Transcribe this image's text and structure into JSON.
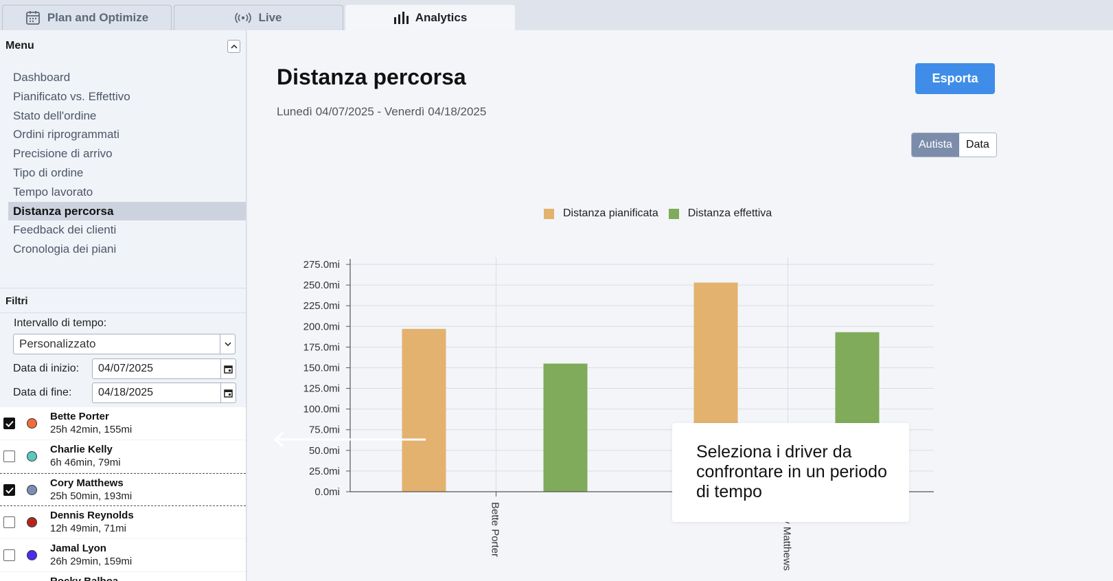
{
  "tabs": [
    {
      "label": "Plan and Optimize",
      "icon": "calendar-icon",
      "active": false
    },
    {
      "label": "Live",
      "icon": "broadcast-icon",
      "active": false
    },
    {
      "label": "Analytics",
      "icon": "bar-chart-icon",
      "active": true
    }
  ],
  "sidebar": {
    "menu_title": "Menu",
    "menu_items": [
      {
        "label": "Dashboard",
        "active": false
      },
      {
        "label": "Pianificato vs. Effettivo",
        "active": false
      },
      {
        "label": "Stato dell'ordine",
        "active": false
      },
      {
        "label": "Ordini riprogrammati",
        "active": false
      },
      {
        "label": "Precisione di arrivo",
        "active": false
      },
      {
        "label": "Tipo di ordine",
        "active": false
      },
      {
        "label": "Tempo lavorato",
        "active": false
      },
      {
        "label": "Distanza percorsa",
        "active": true
      },
      {
        "label": "Feedback dei clienti",
        "active": false
      },
      {
        "label": "Cronologia dei piani",
        "active": false
      }
    ],
    "filters": {
      "title": "Filtri",
      "interval_label": "Intervallo di tempo:",
      "interval_value": "Personalizzato",
      "start_label": "Data di inizio:",
      "start_value": "04/07/2025",
      "end_label": "Data di fine:",
      "end_value": "04/18/2025"
    },
    "drivers": [
      {
        "name": "Bette Porter",
        "stats": "25h 42min, 155mi",
        "checked": true,
        "color": "#f26b3a"
      },
      {
        "name": "Charlie Kelly",
        "stats": "6h 46min, 79mi",
        "checked": false,
        "color": "#5bc8c0"
      },
      {
        "name": "Cory Matthews",
        "stats": "25h 50min, 193mi",
        "checked": true,
        "color": "#7a8fb3"
      },
      {
        "name": "Dennis Reynolds",
        "stats": "12h 49min, 71mi",
        "checked": false,
        "color": "#b3261e"
      },
      {
        "name": "Jamal Lyon",
        "stats": "26h 29min, 159mi",
        "checked": false,
        "color": "#4a2cf0"
      },
      {
        "name": "Rocky Balboa",
        "stats": "",
        "checked": false,
        "color": "#888888"
      }
    ]
  },
  "main": {
    "title": "Distanza percorsa",
    "date_range": "Lunedì 04/07/2025 - Venerdì 04/18/2025",
    "export_label": "Esporta",
    "toggle": {
      "on": "Autista",
      "off": "Data"
    },
    "callout": "Seleziona i driver da confrontare in un periodo di tempo"
  },
  "colors": {
    "planned": "#e2b26e",
    "actual": "#7fab5a",
    "accent": "#3f8de8"
  },
  "chart_data": {
    "type": "bar",
    "categories": [
      "Bette Porter",
      "Cory Matthews"
    ],
    "series": [
      {
        "name": "Distanza pianificata",
        "values": [
          197,
          253
        ]
      },
      {
        "name": "Distanza effettiva",
        "values": [
          155,
          193
        ]
      }
    ],
    "yticks": [
      "0.0mi",
      "25.0mi",
      "50.0mi",
      "75.0mi",
      "100.0mi",
      "125.0mi",
      "150.0mi",
      "175.0mi",
      "200.0mi",
      "225.0mi",
      "250.0mi",
      "275.0mi"
    ],
    "ylim": [
      0,
      275
    ],
    "grid": true,
    "legend": "top-center"
  }
}
